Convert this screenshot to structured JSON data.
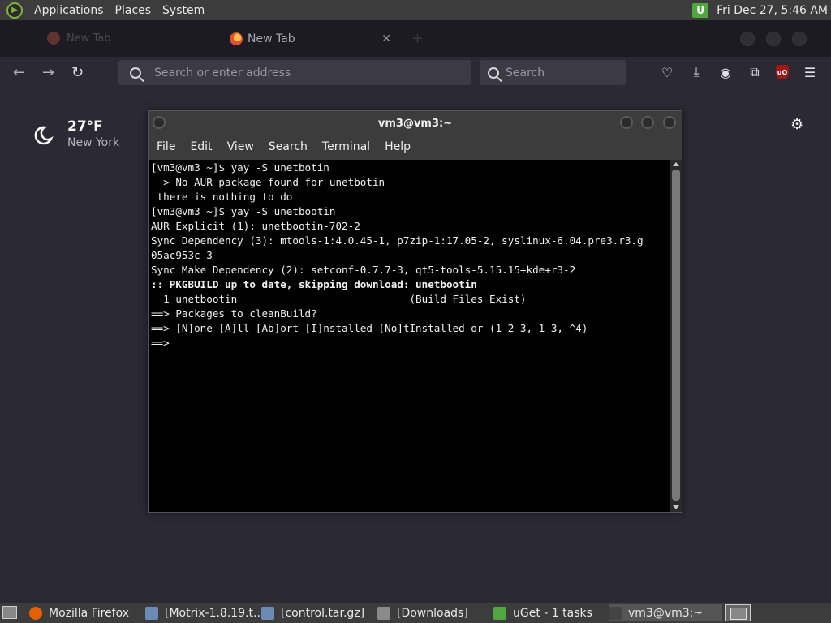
{
  "top_panel": {
    "menus": [
      "Applications",
      "Places",
      "System"
    ],
    "clock": "Fri Dec 27,  5:46 AM",
    "tray_icon": "uget-tray-icon"
  },
  "firefox": {
    "faded_tab_label": "New Tab",
    "tab_label": "New Tab",
    "url_placeholder": "Search or enter address",
    "search_placeholder": "Search",
    "weather": {
      "temp": "27°F",
      "city": "New York"
    }
  },
  "terminal": {
    "title": "vm3@vm3:~",
    "menu": [
      "File",
      "Edit",
      "View",
      "Search",
      "Terminal",
      "Help"
    ],
    "lines": [
      {
        "text": "[vm3@vm3 ~]$ yay -S unetbotin",
        "bold": false
      },
      {
        "text": " -> No AUR package found for unetbotin",
        "bold": false
      },
      {
        "text": " there is nothing to do",
        "bold": false
      },
      {
        "text": "[vm3@vm3 ~]$ yay -S unetbootin",
        "bold": false
      },
      {
        "text": "AUR Explicit (1): unetbootin-702-2",
        "bold": false
      },
      {
        "text": "Sync Dependency (3): mtools-1:4.0.45-1, p7zip-1:17.05-2, syslinux-6.04.pre3.r3.g",
        "bold": false
      },
      {
        "text": "05ac953c-3",
        "bold": false
      },
      {
        "text": "Sync Make Dependency (2): setconf-0.7.7-3, qt5-tools-5.15.15+kde+r3-2",
        "bold": false
      },
      {
        "text": ":: PKGBUILD up to date, skipping download: unetbootin",
        "bold": true
      },
      {
        "text": "  1 unetbootin                            (Build Files Exist)",
        "bold": false
      },
      {
        "text": "==> Packages to cleanBuild?",
        "bold": false
      },
      {
        "text": "==> [N]one [A]ll [Ab]ort [I]nstalled [No]tInstalled or (1 2 3, 1-3, ^4)",
        "bold": false
      },
      {
        "text": "==>",
        "bold": false
      }
    ]
  },
  "taskbar": {
    "tasks": [
      {
        "name": "task-firefox",
        "label": "Mozilla Firefox",
        "icon": "firefox-icon",
        "color": "#e66000"
      },
      {
        "name": "task-motrix",
        "label": "[Motrix-1.8.19.t...",
        "icon": "archive-icon",
        "color": "#6b8bb5"
      },
      {
        "name": "task-control",
        "label": "[control.tar.gz]",
        "icon": "archive-icon",
        "color": "#6b8bb5"
      },
      {
        "name": "task-downloads",
        "label": "[Downloads]",
        "icon": "folder-icon",
        "color": "#8a8a8a"
      },
      {
        "name": "task-uget",
        "label": "uGet - 1 tasks",
        "icon": "uget-icon",
        "color": "#4fa83d"
      },
      {
        "name": "task-terminal",
        "label": "vm3@vm3:~",
        "icon": "terminal-icon",
        "color": "#444"
      }
    ]
  }
}
